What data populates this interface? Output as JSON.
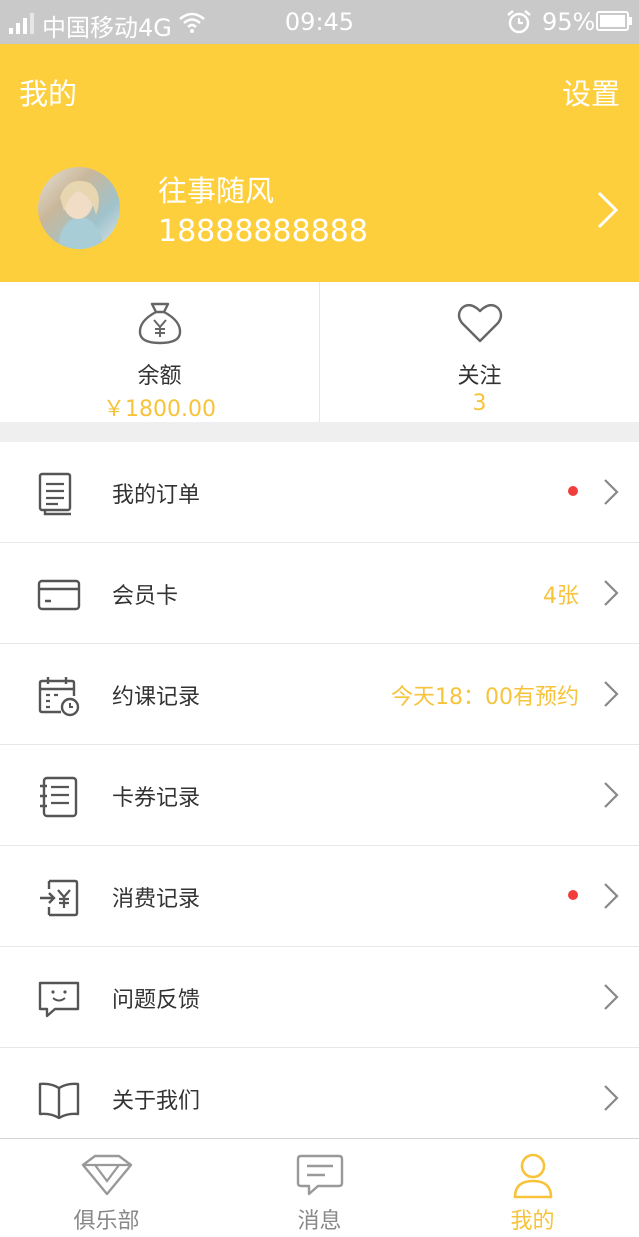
{
  "status_bar": {
    "carrier": "中国移动4G",
    "time": "09:45",
    "battery": "95%"
  },
  "header": {
    "title": "我的",
    "settings": "设置",
    "name": "往事随风",
    "phone": "18888888888"
  },
  "stats": [
    {
      "label": "余额",
      "value": "￥1800.00",
      "icon": "money-bag-icon"
    },
    {
      "label": "关注",
      "value": "3",
      "icon": "heart-icon"
    }
  ],
  "menu": [
    {
      "label": "我的订单",
      "extra": "",
      "dot": true,
      "icon": "document-icon"
    },
    {
      "label": "会员卡",
      "extra": "4张",
      "dot": false,
      "icon": "card-icon"
    },
    {
      "label": "约课记录",
      "extra": "今天18：00有预约",
      "dot": false,
      "icon": "calendar-clock-icon"
    },
    {
      "label": "卡券记录",
      "extra": "",
      "dot": false,
      "icon": "notebook-icon"
    },
    {
      "label": "消费记录",
      "extra": "",
      "dot": true,
      "icon": "yuan-transfer-icon"
    },
    {
      "label": "问题反馈",
      "extra": "",
      "dot": false,
      "icon": "feedback-icon"
    },
    {
      "label": "关于我们",
      "extra": "",
      "dot": false,
      "icon": "book-icon"
    }
  ],
  "tabs": [
    {
      "label": "俱乐部",
      "icon": "diamond-icon"
    },
    {
      "label": "消息",
      "icon": "message-icon"
    },
    {
      "label": "我的",
      "icon": "person-icon"
    }
  ],
  "colors": {
    "accent": "#fecf3c",
    "accent_text": "#f7c33b",
    "badge": "#f23d3d",
    "status_bar": "#c9c9c9"
  }
}
